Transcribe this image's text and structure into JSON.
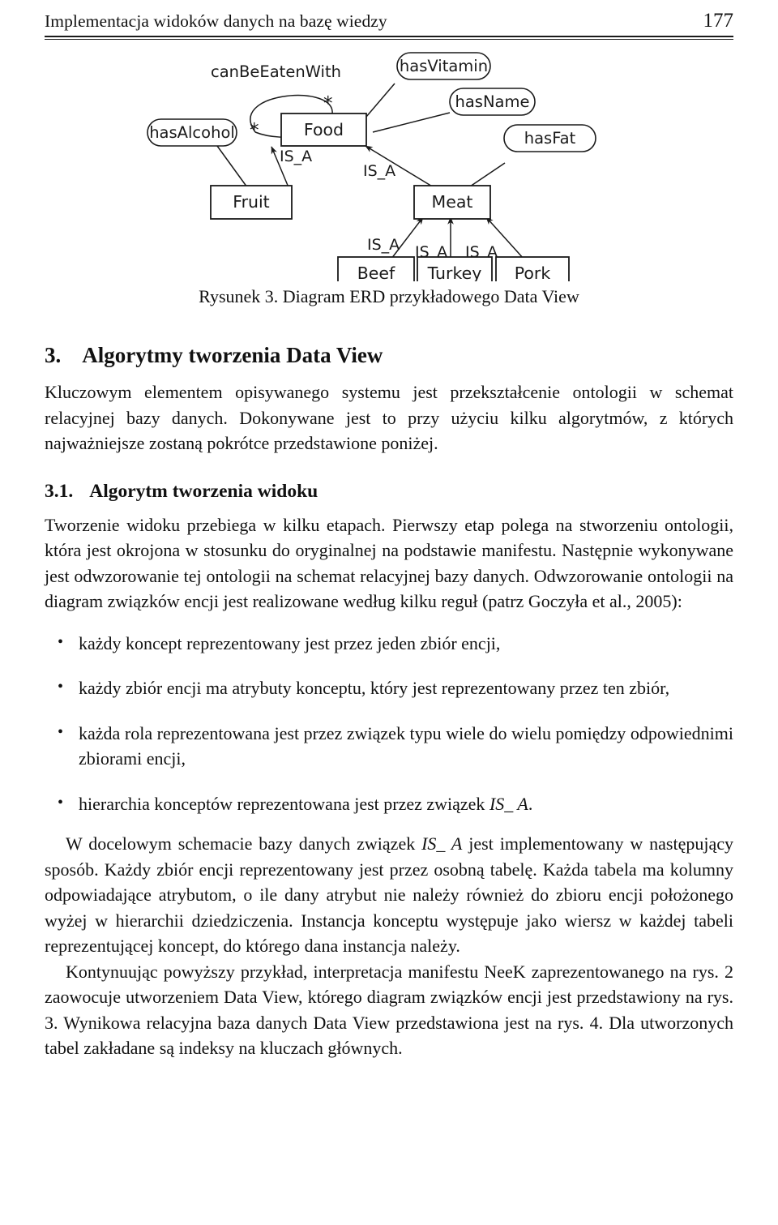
{
  "header": {
    "title": "Implementacja widoków danych na bazę wiedzy",
    "page_number": "177"
  },
  "figure": {
    "caption": "Rysunek 3. Diagram ERD przykładowego Data View",
    "entities": [
      {
        "id": "food",
        "label": "Food"
      },
      {
        "id": "fruit",
        "label": "Fruit"
      },
      {
        "id": "meat",
        "label": "Meat"
      },
      {
        "id": "beef",
        "label": "Beef"
      },
      {
        "id": "turkey",
        "label": "Turkey"
      },
      {
        "id": "pork",
        "label": "Pork"
      }
    ],
    "attributes": [
      {
        "id": "hasVitamin",
        "label": "hasVitamin",
        "owner": "food"
      },
      {
        "id": "hasName",
        "label": "hasName",
        "owner": "food"
      },
      {
        "id": "hasAlcohol",
        "label": "hasAlcohol",
        "owner": "fruit"
      },
      {
        "id": "hasFat",
        "label": "hasFat",
        "owner": "meat"
      }
    ],
    "relation": {
      "label": "canBeEatenWith",
      "from": "food",
      "to": "food",
      "cardinality_left": "*",
      "cardinality_right": "*"
    },
    "is_a_label": "IS_A",
    "is_a_edges": [
      {
        "from": "fruit",
        "to": "food",
        "label": "IS_A"
      },
      {
        "from": "meat",
        "to": "food",
        "label": "IS_A"
      },
      {
        "from": "beef",
        "to": "meat",
        "label": "IS_A"
      },
      {
        "from": "turkey",
        "to": "meat",
        "label": "IS_A"
      },
      {
        "from": "pork",
        "to": "meat",
        "label": "IS_A"
      }
    ],
    "stroke_color": "#1a1a1a",
    "fill_color": "#ffffff"
  },
  "section": {
    "number": "3.",
    "title": "Algorytmy tworzenia Data View",
    "intro": "Kluczowym elementem opisywanego systemu jest przekształcenie ontologii w schemat relacyjnej bazy danych. Dokonywane jest to przy użyciu kilku algorytmów, z których najważniejsze zostaną pokrótce przedstawione poniżej."
  },
  "subsection": {
    "number": "3.1.",
    "title": "Algorytm tworzenia widoku",
    "paragraph": "Tworzenie widoku przebiega w kilku etapach. Pierwszy etap polega na stworzeniu ontologii, która jest okrojona w stosunku do oryginalnej na podstawie manifestu. Następnie wykonywane jest odwzorowanie tej ontologii na schemat relacyjnej bazy danych. Odwzorowanie ontologii na diagram związków encji jest realizowane według kilku reguł (patrz Goczyła et al., 2005):"
  },
  "rules": [
    {
      "text_before": "każdy koncept reprezentowany jest przez jeden zbiór encji,",
      "italic": "",
      "text_after": ""
    },
    {
      "text_before": "każdy zbiór encji ma atrybuty konceptu, który jest reprezentowany przez ten zbiór,",
      "italic": "",
      "text_after": ""
    },
    {
      "text_before": "każda rola reprezentowana jest przez związek typu wiele do wielu pomiędzy odpowiednimi zbiorami encji,",
      "italic": "",
      "text_after": ""
    },
    {
      "text_before": "hierarchia konceptów reprezentowana jest przez związek ",
      "italic": "IS_ A",
      "text_after": "."
    }
  ],
  "closing": {
    "para1_before": "W docelowym schemacie bazy danych związek ",
    "para1_italic": "IS_ A",
    "para1_after": " jest implementowany w następujący sposób. Każdy zbiór encji reprezentowany jest przez osobną tabelę. Każda tabela ma kolumny odpowiadające atrybutom, o ile dany atrybut nie należy również do zbioru encji położonego wyżej w hierarchii dziedziczenia. Instancja konceptu występuje jako wiersz w każdej tabeli reprezentującej koncept, do którego dana instancja należy.",
    "para2": "Kontynuując powyższy przykład, interpretacja manifestu NeeK zaprezentowanego na rys. 2 zaowocuje utworzeniem Data View, którego diagram związków encji jest przedstawiony na rys. 3. Wynikowa relacyjna baza danych Data View przedstawiona jest na rys. 4. Dla utworzonych tabel zakładane są indeksy na kluczach głównych."
  }
}
